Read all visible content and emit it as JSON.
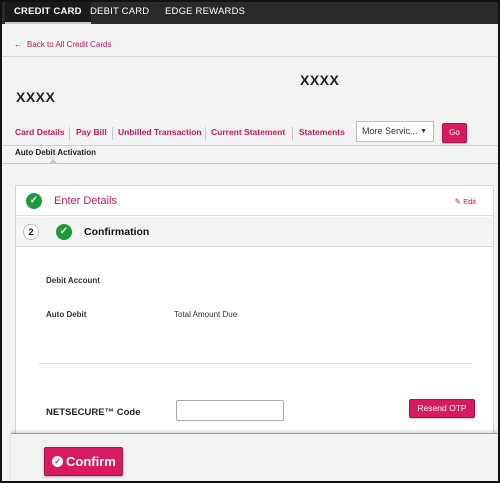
{
  "topnav": {
    "tabs": [
      {
        "label": "CREDIT CARD",
        "active": true
      },
      {
        "label": "DEBIT CARD",
        "active": false
      },
      {
        "label": "EDGE REWARDS",
        "active": false
      }
    ]
  },
  "back_link": {
    "label": "Back to All Credit Cards",
    "icon": "left-arrow-icon"
  },
  "card": {
    "name_line1": "XXXX",
    "name_line2": "XXXX"
  },
  "service_links": [
    "Card Details",
    "Pay Bill",
    "Unbilled Transaction",
    "Current Statement",
    "Statements"
  ],
  "more_services": {
    "selected": "More Servic..."
  },
  "go_button": "Go",
  "subtab": "Auto Debit Activation",
  "steps": {
    "enter_details": {
      "title": "Enter Details",
      "edit_label": "Edit"
    },
    "confirmation": {
      "number": "2",
      "title": "Confirmation"
    }
  },
  "summary": {
    "debit_account_label": "Debit Account",
    "debit_account_value": "",
    "auto_debit_label": "Auto Debit",
    "auto_debit_value": "Total Amount Due"
  },
  "otp": {
    "label": "NETSECURE™ Code",
    "value": "",
    "resend_label": "Resend OTP"
  },
  "confirm_button": "Confirm",
  "colors": {
    "accent": "#d81b60",
    "success": "#1f9a3a",
    "nav_bg": "#2a2a2a"
  }
}
